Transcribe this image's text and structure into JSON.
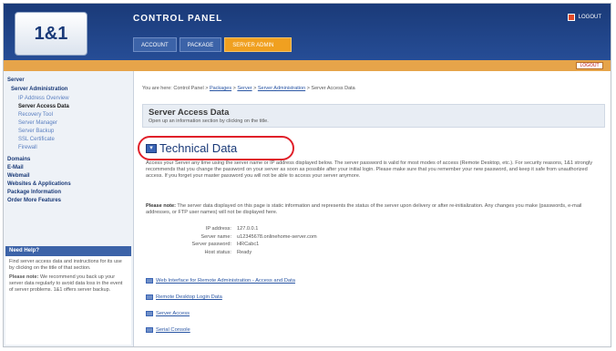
{
  "header": {
    "logo": "1&1",
    "title": "CONTROL PANEL",
    "tabs": [
      {
        "label": "ACCOUNT"
      },
      {
        "label": "PACKAGE"
      },
      {
        "label": "SERVER ADMIN"
      }
    ],
    "logout_label": "LOGOUT"
  },
  "subbar": {
    "button_label": "LOGOUT"
  },
  "nav": {
    "servers_label": "Server",
    "section_title": "Server Administration",
    "items": [
      {
        "label": "IP Address Overview"
      },
      {
        "label": "Server Access Data"
      },
      {
        "label": "Recovery Tool"
      },
      {
        "label": "Server Manager"
      },
      {
        "label": "Server Backup"
      },
      {
        "label": "SSL Certificate"
      },
      {
        "label": "Firewall"
      }
    ],
    "groups": [
      {
        "label": "Domains"
      },
      {
        "label": "E-Mail"
      },
      {
        "label": "Webmail"
      },
      {
        "label": "Websites & Applications"
      },
      {
        "label": "Package Information"
      },
      {
        "label": "Order More Features"
      }
    ],
    "help": {
      "title": "Need Help?",
      "text1": "Find server access data and instructions for its use by clicking on the title of that section.",
      "text2_bold": "Please note:",
      "text2": "We recommend you back up your server data regularly to avoid data loss in the event of server problems. 1&1 offers server backup."
    }
  },
  "main": {
    "breadcrumb": {
      "prefix": "You are here: Control Panel >",
      "links": [
        "Packages",
        "Server",
        "Server Administration"
      ],
      "current": "> Server Access Data"
    },
    "page_title": "Server Access Data",
    "page_subtitle": "Open up an information section by clicking on the title.",
    "section_title": "Technical Data",
    "para1": "Access your Server any time using the server name or IP address displayed below. The server password is valid for most modes of access (Remote Desktop, etc.). For security reasons, 1&1 strongly recommends that you change the password on your server as soon as possible after your initial login. Please make sure that you remember your new password, and keep it safe from unauthorized access. If you forget your master password you will not be able to access your server anymore.",
    "para2_bold": "Please note:",
    "para2": "The server data displayed on this page is static information and represents the status of the server upon delivery or after re-initialization. Any changes you make (passwords, e-mail addresses, or FTP user names) will not be displayed here.",
    "info": [
      {
        "label": "IP address:",
        "value": "127.0.0.1"
      },
      {
        "label": "Server name:",
        "value": "u12345678.onlinehome-server.com"
      },
      {
        "label": "Server password:",
        "value": "HRCabc1"
      },
      {
        "label": "Host status:",
        "value": "Ready"
      }
    ],
    "links": [
      {
        "label": "Web Interface for Remote Administration - Access and Data"
      },
      {
        "label": "Remote Desktop Login Data"
      },
      {
        "label": "Server Access"
      },
      {
        "label": "Serial Console"
      }
    ]
  }
}
